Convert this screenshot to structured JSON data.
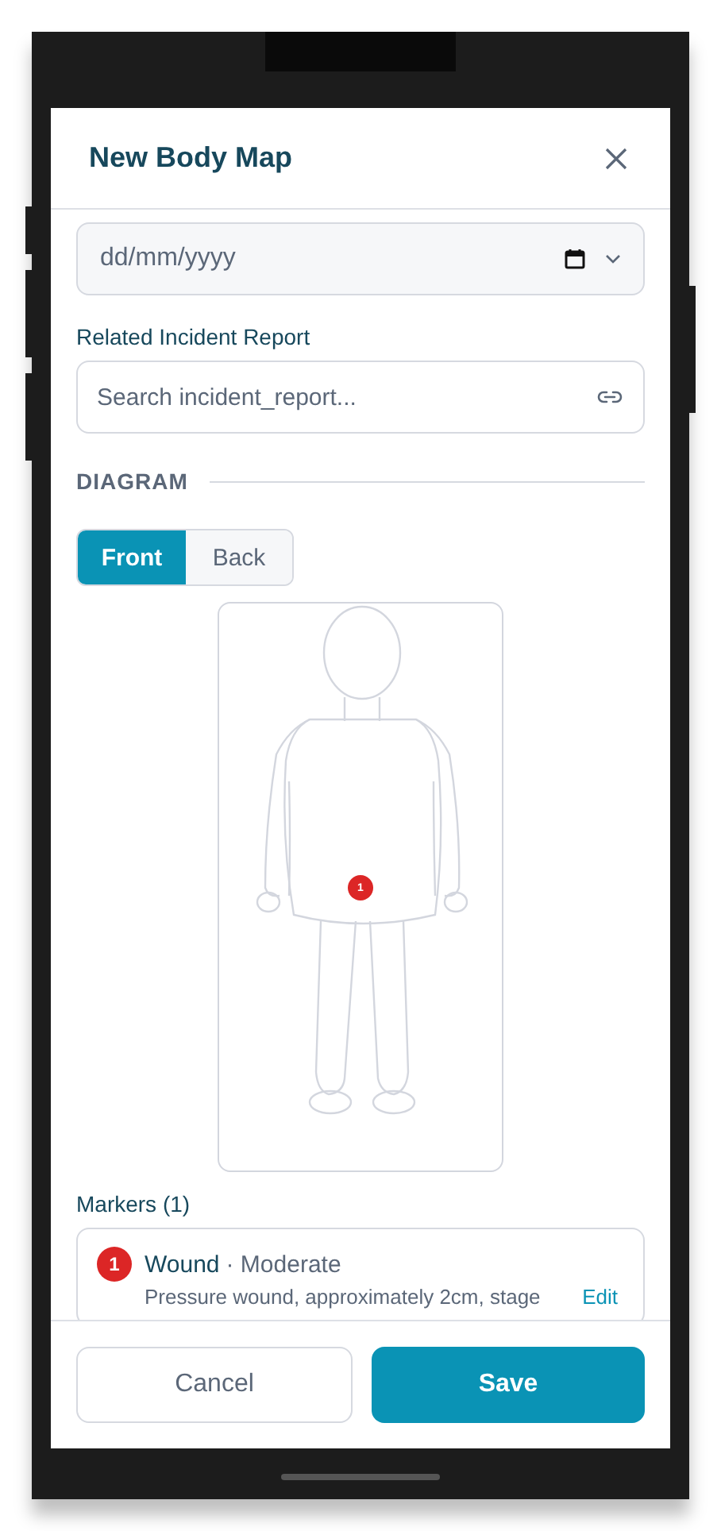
{
  "dialog": {
    "title": "New Body Map"
  },
  "date_field": {
    "placeholder": "dd/mm/yyyy"
  },
  "incident_field": {
    "label": "Related Incident Report",
    "placeholder": "Search incident_report..."
  },
  "diagram": {
    "heading": "DIAGRAM",
    "views": [
      {
        "label": "Front",
        "selected": true
      },
      {
        "label": "Back",
        "selected": false
      }
    ],
    "pins": [
      {
        "number": "1"
      }
    ]
  },
  "markers": {
    "heading": "Markers (1)",
    "items": [
      {
        "number": "1",
        "type": "Wound",
        "severity": "· Moderate",
        "description": "Pressure wound, approximately 2cm, stage",
        "action": "Edit"
      }
    ]
  },
  "footer": {
    "buttons": [
      {
        "label": "Cancel",
        "kind": "secondary"
      },
      {
        "label": "Save",
        "kind": "primary"
      }
    ]
  }
}
